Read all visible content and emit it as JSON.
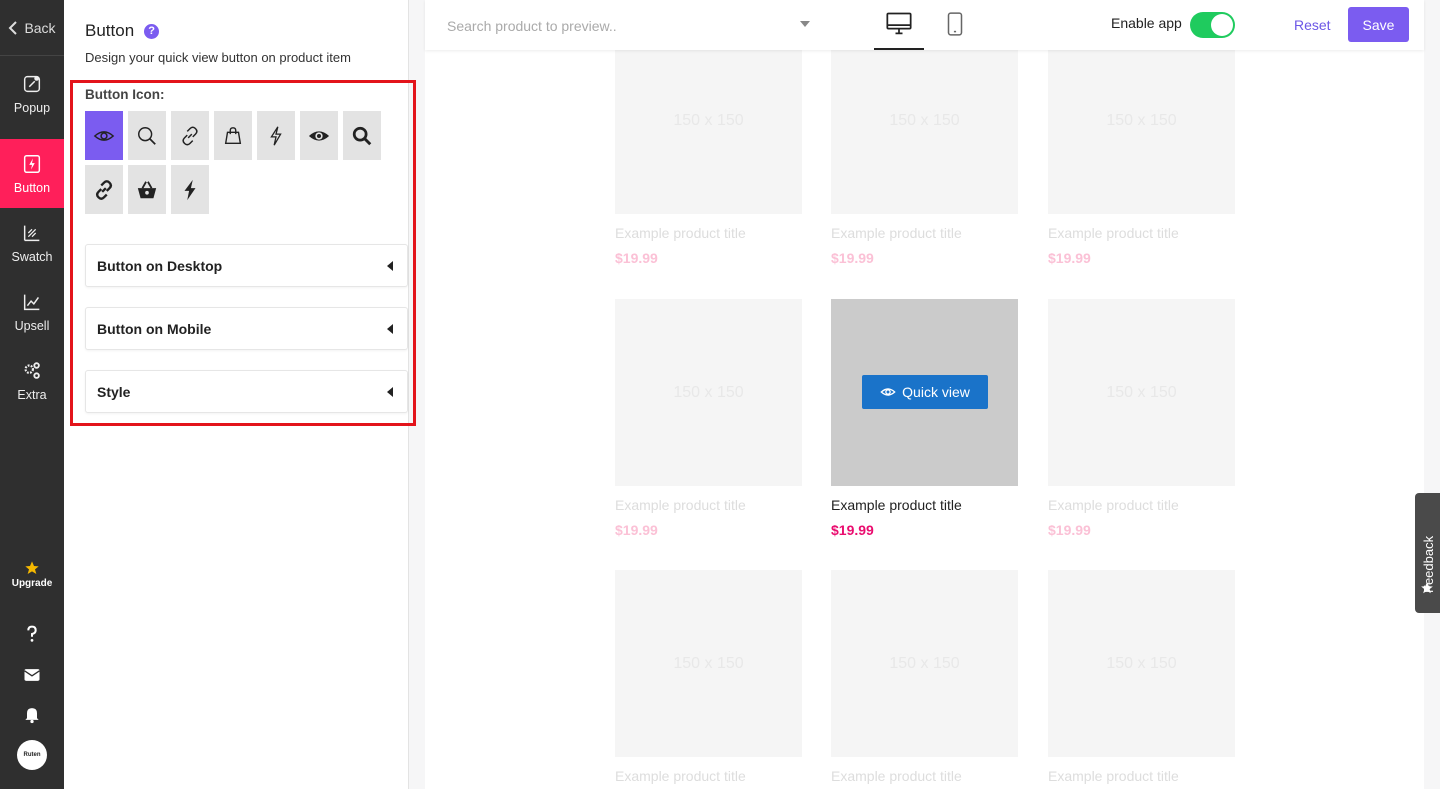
{
  "nav": {
    "back_label": "Back",
    "items": [
      {
        "label": "Popup"
      },
      {
        "label": "Button"
      },
      {
        "label": "Swatch"
      },
      {
        "label": "Upsell"
      },
      {
        "label": "Extra"
      }
    ],
    "upgrade_label": "Upgrade",
    "avatar_text": "Ruten"
  },
  "panel": {
    "title": "Button",
    "subtitle": "Design your quick view button on product item",
    "icon_label": "Button Icon:",
    "icons": [
      "eye-outline",
      "search",
      "link",
      "bag",
      "lightning-outline",
      "eye-filled",
      "search-bold",
      "link-bold",
      "basket",
      "lightning-filled"
    ],
    "sections": [
      "Button on Desktop",
      "Button on Mobile",
      "Style"
    ]
  },
  "topbar": {
    "search_placeholder": "Search product to preview..",
    "enable_label": "Enable app",
    "enabled": true,
    "reset_label": "Reset",
    "save_label": "Save"
  },
  "products": {
    "placeholder": "150 x 150",
    "title": "Example product title",
    "price": "$19.99",
    "quick_view_label": "Quick view"
  },
  "feedback_label": "Feedback",
  "colors": {
    "accent": "#7b5cf0",
    "nav_active": "#ff1f5a",
    "price": "#ea0d6f",
    "quick_view": "#1a73c9",
    "toggle_on": "#1fcb5e"
  }
}
